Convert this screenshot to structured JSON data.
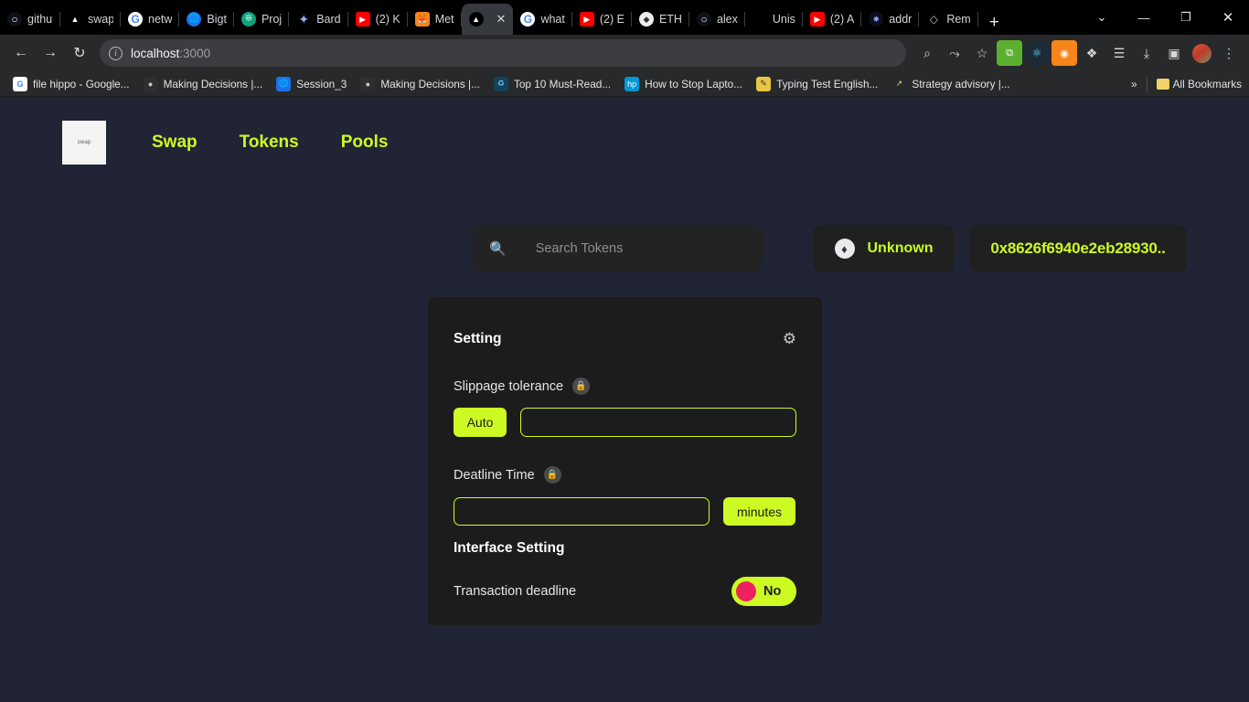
{
  "browser": {
    "tabs": [
      {
        "label": "github",
        "icon": "github-icon",
        "active": false
      },
      {
        "label": "swap",
        "icon": "uniswap-icon",
        "active": false
      },
      {
        "label": "netw",
        "icon": "google-icon",
        "active": false
      },
      {
        "label": "Bigt",
        "icon": "bigt-icon",
        "active": false
      },
      {
        "label": "Proj",
        "icon": "chatgpt-icon",
        "active": false
      },
      {
        "label": "Bard",
        "icon": "bard-icon",
        "active": false
      },
      {
        "label": "(2) K",
        "icon": "youtube-icon",
        "active": false
      },
      {
        "label": "Met",
        "icon": "metamask-icon",
        "active": false
      },
      {
        "label": "",
        "icon": "uniswap-icon",
        "active": true
      },
      {
        "label": "what",
        "icon": "google-icon",
        "active": false
      },
      {
        "label": "(2) E",
        "icon": "youtube-icon",
        "active": false
      },
      {
        "label": "ETH",
        "icon": "ethereum-icon",
        "active": false
      },
      {
        "label": "alex",
        "icon": "github-icon",
        "active": false
      },
      {
        "label": "Unis",
        "icon": "none",
        "active": false
      },
      {
        "label": "(2) A",
        "icon": "youtube-icon",
        "active": false
      },
      {
        "label": "addr",
        "icon": "address-icon",
        "active": false
      },
      {
        "label": "Rem",
        "icon": "remix-icon",
        "active": false
      }
    ],
    "new_tab_glyph": "+",
    "window_controls": {
      "tab_search": "⌄",
      "minimize": "—",
      "maximize": "❐",
      "close": "✕"
    },
    "toolbar": {
      "back": "←",
      "forward": "→",
      "reload": "↻",
      "url_host": "localhost",
      "url_rest": ":3000",
      "info_glyph": "i",
      "zoom_glyph": "⌕",
      "share_glyph": "⤳",
      "bookmark_star": "☆",
      "ext_green": "⧉",
      "ext_react": "⚛",
      "ext_fox": "◉",
      "puzzle": "❖",
      "reading_list": "☰",
      "download": "⤓",
      "sidepanel": "▣",
      "menu": "⋮"
    },
    "bookmarks": [
      {
        "label": "file hippo - Google...",
        "icon": "google-icon"
      },
      {
        "label": "Making Decisions |...",
        "icon": "dark-icon"
      },
      {
        "label": "Session_3",
        "icon": "blue-globe-icon"
      },
      {
        "label": "Making Decisions |...",
        "icon": "dark-icon"
      },
      {
        "label": "Top 10 Must-Read...",
        "icon": "teal-icon"
      },
      {
        "label": "How to Stop Lapto...",
        "icon": "hp-icon"
      },
      {
        "label": "Typing Test English...",
        "icon": "yellow-icon"
      },
      {
        "label": "Strategy advisory |...",
        "icon": "line-icon"
      }
    ],
    "bookmarks_overflow": "»",
    "all_bookmarks_label": "All Bookmarks"
  },
  "app": {
    "logo_text": "swap",
    "nav": [
      {
        "label": "Swap"
      },
      {
        "label": "Tokens"
      },
      {
        "label": "Pools"
      }
    ],
    "search": {
      "placeholder": "Search Tokens",
      "icon": "search-icon",
      "value": ""
    },
    "chain": {
      "label": "Unknown",
      "icon": "ethereum-icon"
    },
    "wallet_address": "0x8626f6940e2eb28930..",
    "colors": {
      "accent": "#cdfa23",
      "knob": "#ef2060",
      "page_bg": "#202434",
      "card_bg": "#1c1c1c"
    }
  },
  "settings_card": {
    "title": "Setting",
    "gear_icon": "gear-icon",
    "slippage": {
      "label": "Slippage tolerance",
      "info_icon": "lock-icon",
      "auto_label": "Auto",
      "input_value": "",
      "input_placeholder": ""
    },
    "deadline": {
      "label": "Deatline Time",
      "info_icon": "lock-icon",
      "input_value": "",
      "input_placeholder": "",
      "unit_label": "minutes"
    },
    "interface": {
      "title": "Interface Setting",
      "transaction_deadline_label": "Transaction deadline",
      "toggle_state": "No"
    }
  }
}
